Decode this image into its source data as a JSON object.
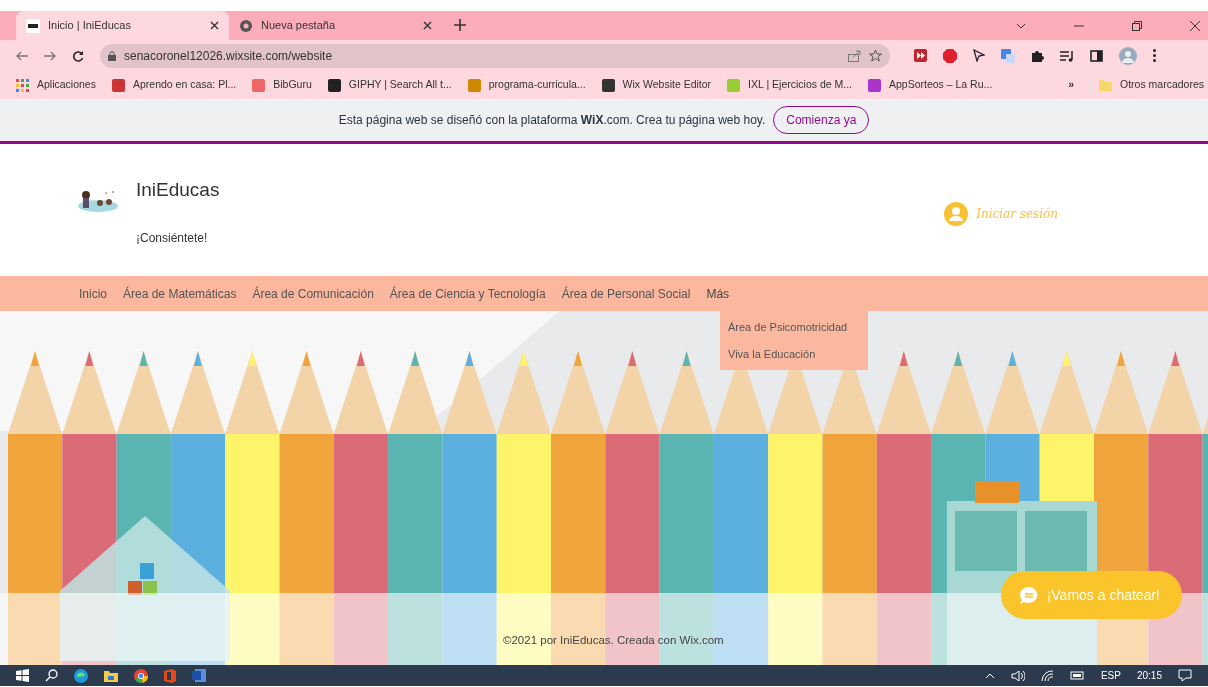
{
  "browser": {
    "tabs": [
      {
        "title": "Inicio | IniEducas",
        "selected": true
      },
      {
        "title": "Nueva pestaña",
        "selected": false
      }
    ],
    "address": "senacoronel12026.wixsite.com/website",
    "bookmarks": [
      "Aplicaciones",
      "Aprendo en casa: Pl...",
      "BibGuru",
      "GIPHY | Search All t...",
      "programa-curricula...",
      "Wix Website Editor",
      "IXL | Ejercicios de M...",
      "AppSorteos – La Ru..."
    ],
    "bookmarks_overflow": "»",
    "other_bookmarks": "Otros marcadores"
  },
  "wix_banner": {
    "text": "Esta página web se diseñó con la plataforma **WiX**.com. Crea tu página web hoy.",
    "button": "Comienza ya"
  },
  "site": {
    "title": "IniEducas",
    "tagline": "¡Consiéntete!",
    "login": "Iniciar sesión",
    "nav": [
      {
        "label": "Inicio"
      },
      {
        "label": "Área de Matemáticas"
      },
      {
        "label": "Área de Comunicación"
      },
      {
        "label": "Área de Ciencia y Tecnología"
      },
      {
        "label": "Área de Personal Social"
      },
      {
        "label": "Más",
        "expanded": true
      }
    ],
    "dropdown": [
      "Área de Psicomotricidad",
      "Viva la Educación"
    ],
    "footer": "©2021 por IniEducas. Creada con Wix.com",
    "chat_button": "¡Vamos a chatear!"
  },
  "taskbar": {
    "language": "ESP",
    "time": "20:15"
  }
}
